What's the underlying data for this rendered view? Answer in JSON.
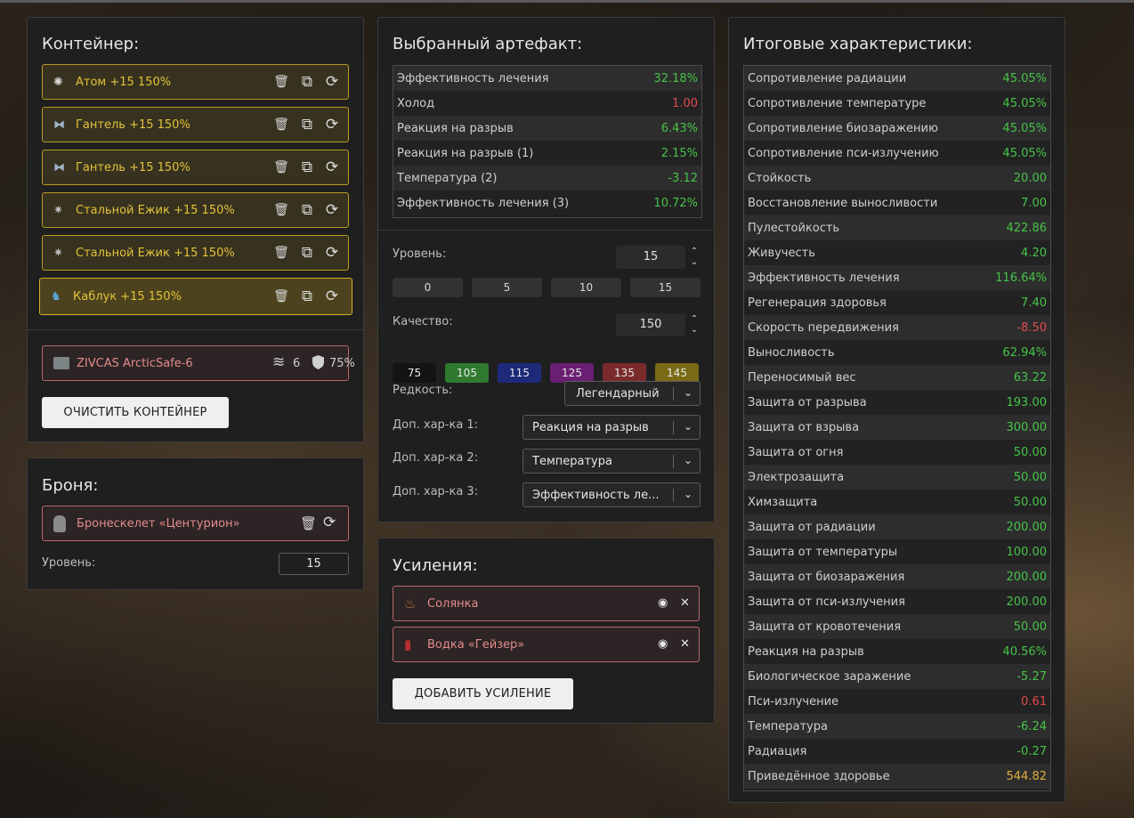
{
  "container": {
    "title": "Контейнер:",
    "items": [
      {
        "label": "Атом +15 150%",
        "icon": "atom-icon"
      },
      {
        "label": "Гантель +15 150%",
        "icon": "dumbbell-icon"
      },
      {
        "label": "Гантель +15 150%",
        "icon": "dumbbell-icon"
      },
      {
        "label": "Стальной Ежик +15 150%",
        "icon": "steel-hedgehog-icon"
      },
      {
        "label": "Стальной Ежик +15 150%",
        "icon": "steel-hedgehog-icon"
      },
      {
        "label": "Каблук +15 150%",
        "icon": "heel-icon"
      }
    ],
    "case": {
      "label": "ZIVCAS ArcticSafe-6",
      "slots": "6",
      "protection": "75%"
    },
    "clear_button": "ОЧИСТИТЬ КОНТЕЙНЕР"
  },
  "armor": {
    "title": "Броня:",
    "item": "Бронескелет «Центурион»",
    "level_label": "Уровень:",
    "level_value": "15"
  },
  "artifact": {
    "title": "Выбранный артефакт:",
    "stats": [
      {
        "name": "Эффективность лечения",
        "value": "32.18%",
        "tone": "pos"
      },
      {
        "name": "Холод",
        "value": "1.00",
        "tone": "neg"
      },
      {
        "name": "Реакция на разрыв",
        "value": "6.43%",
        "tone": "pos"
      },
      {
        "name": "Реакция на разрыв (1)",
        "value": "2.15%",
        "tone": "pos"
      },
      {
        "name": "Температура (2)",
        "value": "-3.12",
        "tone": "pos"
      },
      {
        "name": "Эффективность лечения (3)",
        "value": "10.72%",
        "tone": "pos"
      }
    ],
    "level_label": "Уровень:",
    "level_value": "15",
    "level_presets": [
      "0",
      "5",
      "10",
      "15"
    ],
    "quality_label": "Качество:",
    "quality_value": "150",
    "quality_presets": [
      {
        "label": "75",
        "color": "#141414"
      },
      {
        "label": "105",
        "color": "#2f7a2f"
      },
      {
        "label": "115",
        "color": "#1d2a7a"
      },
      {
        "label": "125",
        "color": "#6a1f72"
      },
      {
        "label": "135",
        "color": "#7a2a2a"
      },
      {
        "label": "145",
        "color": "#7a6a15"
      }
    ],
    "rarity_label": "Редкость:",
    "rarity_value": "Легендарный",
    "extra1_label": "Доп. хар-ка 1:",
    "extra1_value": "Реакция на разрыв",
    "extra2_label": "Доп. хар-ка 2:",
    "extra2_value": "Температура",
    "extra3_label": "Доп. хар-ка 3:",
    "extra3_value": "Эффективность ле..."
  },
  "boosts": {
    "title": "Усиления:",
    "items": [
      {
        "label": "Солянка",
        "icon": "soup-icon"
      },
      {
        "label": "Водка «Гейзер»",
        "icon": "bottle-icon"
      }
    ],
    "add_button": "ДОБАВИТЬ УСИЛЕНИЕ"
  },
  "totals": {
    "title": "Итоговые характеристики:",
    "stats": [
      {
        "name": "Сопротивление радиации",
        "value": "45.05%",
        "tone": "pos"
      },
      {
        "name": "Сопротивление температуре",
        "value": "45.05%",
        "tone": "pos"
      },
      {
        "name": "Сопротивление биозаражению",
        "value": "45.05%",
        "tone": "pos"
      },
      {
        "name": "Сопротивление пси-излучению",
        "value": "45.05%",
        "tone": "pos"
      },
      {
        "name": "Стойкость",
        "value": "20.00",
        "tone": "pos"
      },
      {
        "name": "Восстановление выносливости",
        "value": "7.00",
        "tone": "pos"
      },
      {
        "name": "Пулестойкость",
        "value": "422.86",
        "tone": "pos"
      },
      {
        "name": "Живучесть",
        "value": "4.20",
        "tone": "pos"
      },
      {
        "name": "Эффективность лечения",
        "value": "116.64%",
        "tone": "pos"
      },
      {
        "name": "Регенерация здоровья",
        "value": "7.40",
        "tone": "pos"
      },
      {
        "name": "Скорость передвижения",
        "value": "-8.50",
        "tone": "neg"
      },
      {
        "name": "Выносливость",
        "value": "62.94%",
        "tone": "pos"
      },
      {
        "name": "Переносимый вес",
        "value": "63.22",
        "tone": "pos"
      },
      {
        "name": "Защита от разрыва",
        "value": "193.00",
        "tone": "pos"
      },
      {
        "name": "Защита от взрыва",
        "value": "300.00",
        "tone": "pos"
      },
      {
        "name": "Защита от огня",
        "value": "50.00",
        "tone": "pos"
      },
      {
        "name": "Электрозащита",
        "value": "50.00",
        "tone": "pos"
      },
      {
        "name": "Химзащита",
        "value": "50.00",
        "tone": "pos"
      },
      {
        "name": "Защита от радиации",
        "value": "200.00",
        "tone": "pos"
      },
      {
        "name": "Защита от температуры",
        "value": "100.00",
        "tone": "pos"
      },
      {
        "name": "Защита от биозаражения",
        "value": "200.00",
        "tone": "pos"
      },
      {
        "name": "Защита от пси-излучения",
        "value": "200.00",
        "tone": "pos"
      },
      {
        "name": "Защита от кровотечения",
        "value": "50.00",
        "tone": "pos"
      },
      {
        "name": "Реакция на разрыв",
        "value": "40.56%",
        "tone": "pos"
      },
      {
        "name": "Биологическое заражение",
        "value": "-5.27",
        "tone": "pos"
      },
      {
        "name": "Пси-излучение",
        "value": "0.61",
        "tone": "neg"
      },
      {
        "name": "Температура",
        "value": "-6.24",
        "tone": "pos"
      },
      {
        "name": "Радиация",
        "value": "-0.27",
        "tone": "pos"
      },
      {
        "name": "Приведённое здоровье",
        "value": "544.82",
        "tone": "gold"
      }
    ]
  },
  "colors": {
    "positive": "#47c447",
    "negative": "#e24a4a",
    "highlight": "#e0b03a",
    "item_gold": "#e3c23a"
  }
}
